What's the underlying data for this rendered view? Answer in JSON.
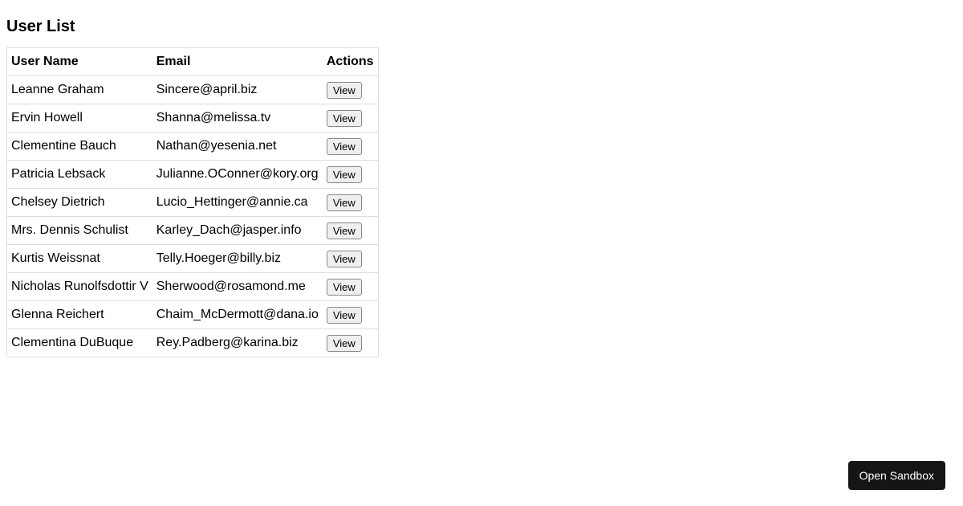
{
  "page": {
    "title": "User List"
  },
  "table": {
    "headers": {
      "name": "User Name",
      "email": "Email",
      "actions": "Actions"
    },
    "view_label": "View",
    "rows": [
      {
        "name": "Leanne Graham",
        "email": "Sincere@april.biz"
      },
      {
        "name": "Ervin Howell",
        "email": "Shanna@melissa.tv"
      },
      {
        "name": "Clementine Bauch",
        "email": "Nathan@yesenia.net"
      },
      {
        "name": "Patricia Lebsack",
        "email": "Julianne.OConner@kory.org"
      },
      {
        "name": "Chelsey Dietrich",
        "email": "Lucio_Hettinger@annie.ca"
      },
      {
        "name": "Mrs. Dennis Schulist",
        "email": "Karley_Dach@jasper.info"
      },
      {
        "name": "Kurtis Weissnat",
        "email": "Telly.Hoeger@billy.biz"
      },
      {
        "name": "Nicholas Runolfsdottir V",
        "email": "Sherwood@rosamond.me"
      },
      {
        "name": "Glenna Reichert",
        "email": "Chaim_McDermott@dana.io"
      },
      {
        "name": "Clementina DuBuque",
        "email": "Rey.Padberg@karina.biz"
      }
    ]
  },
  "footer": {
    "sandbox_label": "Open Sandbox"
  }
}
